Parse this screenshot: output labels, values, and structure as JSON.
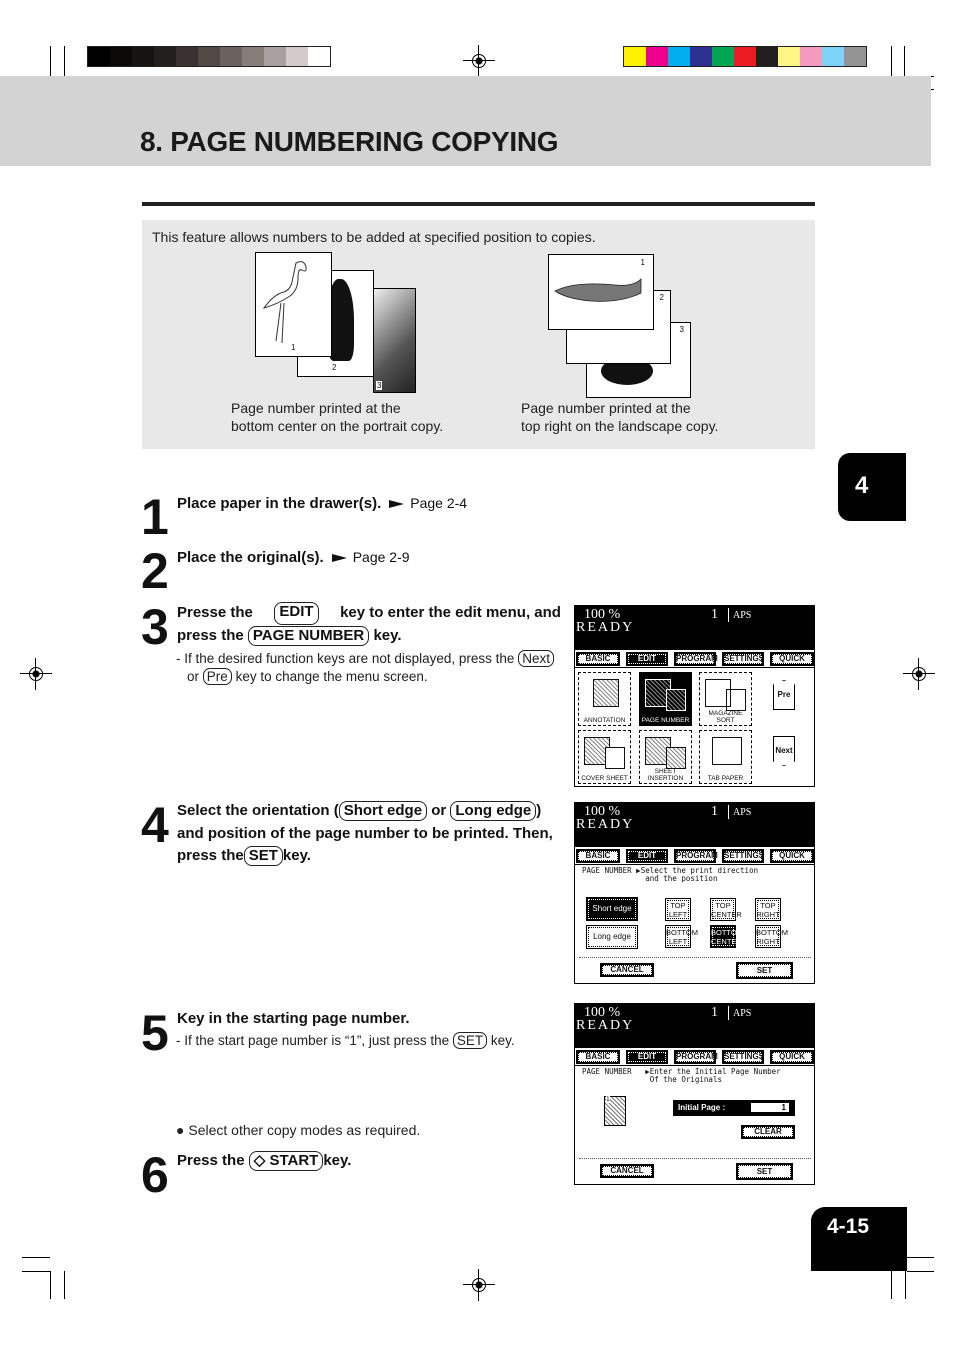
{
  "print_marks": {
    "gray_swatches": [
      "#000000",
      "#0b0a09",
      "#161311",
      "#231f1c",
      "#3a3230",
      "#514946",
      "#6b615e",
      "#877e7b",
      "#a8a09e",
      "#d3cbc9",
      "#ffffff"
    ],
    "color_swatches": [
      "#fff200",
      "#ec008c",
      "#00aeef",
      "#2e3192",
      "#00a651",
      "#ed1c24",
      "#231f20",
      "#fff685",
      "#f49ac1",
      "#7dd3f7",
      "#939393"
    ]
  },
  "header": {
    "title": "8. PAGE NUMBERING COPYING"
  },
  "intro": {
    "text": "This feature allows numbers to be added at specified position to copies.",
    "portrait": {
      "page_numbers": [
        "1",
        "2",
        "3"
      ],
      "caption_line1": "Page number printed at the",
      "caption_line2": "bottom center on the portrait copy."
    },
    "landscape": {
      "page_numbers": [
        "1",
        "2",
        "3"
      ],
      "caption_line1": "Page number printed at the",
      "caption_line2": "top right on the landscape copy."
    }
  },
  "chapter_tab": "4",
  "page_number": "4-15",
  "steps": [
    {
      "num": "1",
      "text": "Place paper in the drawer(s).",
      "ref": "Page 2-4"
    },
    {
      "num": "2",
      "text": "Place the original(s).",
      "ref": "Page 2-9"
    },
    {
      "num": "3",
      "text_a": "Presse the",
      "key_a": "EDIT",
      "text_b": "key to enter the edit menu, and",
      "text_c": "press the",
      "key_b": "PAGE NUMBER",
      "text_d": "key.",
      "note_a": "- If the desired function keys are not displayed, press the",
      "note_key_a": "Next",
      "note_b": "or",
      "note_key_b": "Pre",
      "note_c": "key to change the menu screen."
    },
    {
      "num": "4",
      "text_a": "Select the orientation (",
      "key_a": "Short edge",
      "text_b": "or",
      "key_b": "Long edge",
      "text_c": ")",
      "line2": "and position of the page number to be printed. Then,",
      "text_d": "press the",
      "key_c": "SET",
      "text_e": "key."
    },
    {
      "num": "5",
      "text": "Key in the starting page number.",
      "note_a": "- If the start page number is “1”, just press the",
      "note_key": "SET",
      "note_b": "key."
    },
    {
      "num": "6",
      "pre": "Select other copy modes as required.",
      "text_a": "Press the",
      "key_icon": "◇",
      "key": "START",
      "text_b": "key."
    }
  ],
  "lcd_common": {
    "zoom": "100  %",
    "copies": "1",
    "paper": "APS",
    "status": "READY",
    "tabs": [
      "BASIC",
      "EDIT",
      "PROGRAM",
      "SETTINGS",
      "QUICK"
    ],
    "active_tab": "EDIT"
  },
  "lcd1": {
    "tiles": [
      {
        "label": "ANNOTATION",
        "selected": false
      },
      {
        "label": "PAGE NUMBER",
        "selected": true
      },
      {
        "label": "MAGAZINE SORT",
        "selected": false
      },
      {
        "label": "COVER SHEET",
        "selected": false
      },
      {
        "label": "SHEET INSERTION",
        "selected": false
      },
      {
        "label": "TAB PAPER",
        "selected": false
      }
    ],
    "pre": "Pre",
    "next": "Next"
  },
  "lcd2": {
    "message": "PAGE NUMBER ▶Select the print direction\n              and the position",
    "orientation": [
      {
        "label": "Short edge",
        "selected": true
      },
      {
        "label": "Long edge",
        "selected": false
      }
    ],
    "positions": [
      {
        "l1": "TOP",
        "l2": "LEFT",
        "selected": false
      },
      {
        "l1": "TOP",
        "l2": "CENTER",
        "selected": false
      },
      {
        "l1": "TOP",
        "l2": "RIGHT",
        "selected": false
      },
      {
        "l1": "BOTTOM",
        "l2": "LEFT",
        "selected": false
      },
      {
        "l1": "BOTTOM",
        "l2": "CENTER",
        "selected": true
      },
      {
        "l1": "BOTTOM",
        "l2": "RIGHT",
        "selected": false
      }
    ],
    "cancel": "CANCEL",
    "set": "SET"
  },
  "lcd3": {
    "message": "PAGE NUMBER   ▶Enter the Initial Page Number\n               Of the Originals",
    "doc_number": "1",
    "initial_label": "Initial Page :",
    "initial_value": "1",
    "clear": "CLEAR",
    "cancel": "CANCEL",
    "set": "SET"
  }
}
